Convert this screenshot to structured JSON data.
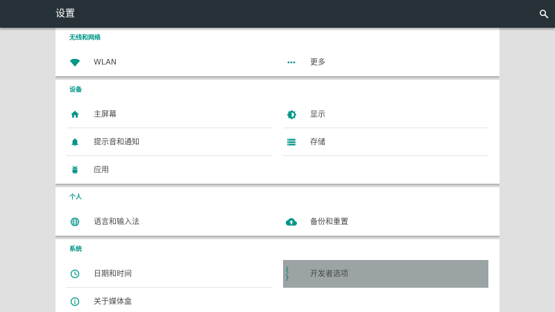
{
  "app_bar": {
    "title": "设置",
    "search_icon": "search-icon"
  },
  "colors": {
    "app_bar": "#263238",
    "accent": "#009688",
    "background": "#e0e0e0",
    "selected_item": "#9ca3a5"
  },
  "sections": [
    {
      "title": "无线和网络",
      "items": [
        {
          "label": "WLAN",
          "icon": "wifi-icon"
        },
        {
          "label": "更多",
          "icon": "more-dots-icon"
        }
      ]
    },
    {
      "title": "设备",
      "items": [
        {
          "label": "主屏幕",
          "icon": "home-icon"
        },
        {
          "label": "显示",
          "icon": "brightness-icon"
        },
        {
          "label": "提示音和通知",
          "icon": "bell-icon"
        },
        {
          "label": "存储",
          "icon": "storage-list-icon"
        },
        {
          "label": "应用",
          "icon": "android-icon"
        }
      ]
    },
    {
      "title": "个人",
      "items": [
        {
          "label": "语言和输入法",
          "icon": "globe-icon"
        },
        {
          "label": "备份和重置",
          "icon": "cloud-upload-icon"
        }
      ]
    },
    {
      "title": "系统",
      "items": [
        {
          "label": "日期和时间",
          "icon": "clock-icon"
        },
        {
          "label": "开发者选项",
          "icon": "braces-icon",
          "selected": true
        },
        {
          "label": "关于媒体盒",
          "icon": "info-icon"
        }
      ]
    }
  ]
}
